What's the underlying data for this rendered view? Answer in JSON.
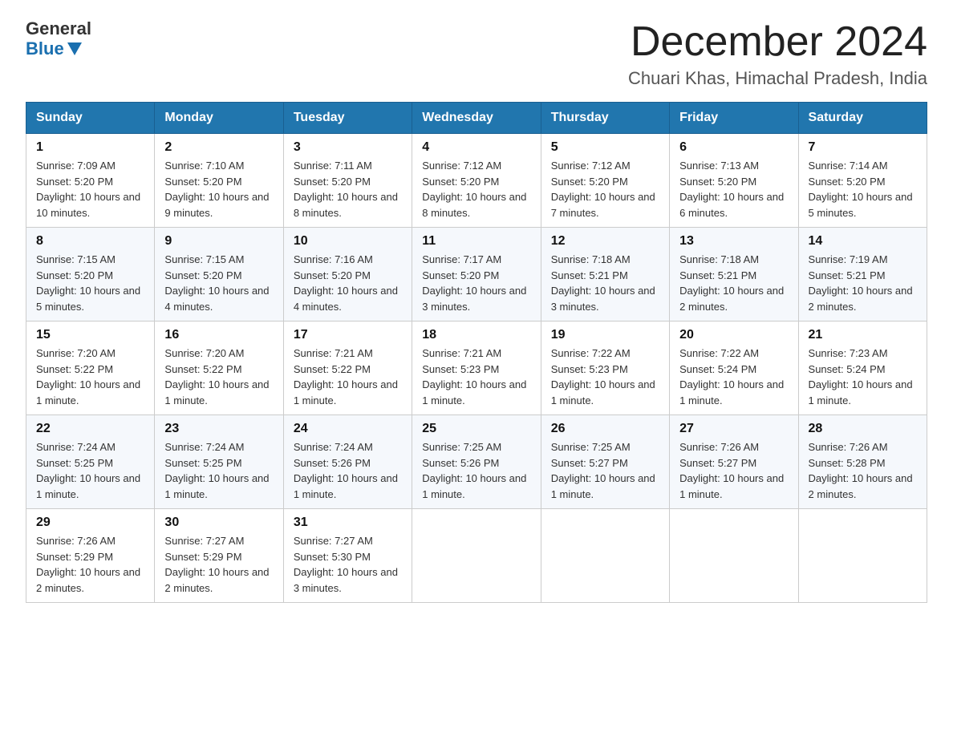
{
  "logo": {
    "general": "General",
    "blue": "Blue"
  },
  "header": {
    "month": "December 2024",
    "location": "Chuari Khas, Himachal Pradesh, India"
  },
  "weekdays": [
    "Sunday",
    "Monday",
    "Tuesday",
    "Wednesday",
    "Thursday",
    "Friday",
    "Saturday"
  ],
  "weeks": [
    [
      {
        "day": "1",
        "sunrise": "7:09 AM",
        "sunset": "5:20 PM",
        "daylight": "10 hours and 10 minutes."
      },
      {
        "day": "2",
        "sunrise": "7:10 AM",
        "sunset": "5:20 PM",
        "daylight": "10 hours and 9 minutes."
      },
      {
        "day": "3",
        "sunrise": "7:11 AM",
        "sunset": "5:20 PM",
        "daylight": "10 hours and 8 minutes."
      },
      {
        "day": "4",
        "sunrise": "7:12 AM",
        "sunset": "5:20 PM",
        "daylight": "10 hours and 8 minutes."
      },
      {
        "day": "5",
        "sunrise": "7:12 AM",
        "sunset": "5:20 PM",
        "daylight": "10 hours and 7 minutes."
      },
      {
        "day": "6",
        "sunrise": "7:13 AM",
        "sunset": "5:20 PM",
        "daylight": "10 hours and 6 minutes."
      },
      {
        "day": "7",
        "sunrise": "7:14 AM",
        "sunset": "5:20 PM",
        "daylight": "10 hours and 5 minutes."
      }
    ],
    [
      {
        "day": "8",
        "sunrise": "7:15 AM",
        "sunset": "5:20 PM",
        "daylight": "10 hours and 5 minutes."
      },
      {
        "day": "9",
        "sunrise": "7:15 AM",
        "sunset": "5:20 PM",
        "daylight": "10 hours and 4 minutes."
      },
      {
        "day": "10",
        "sunrise": "7:16 AM",
        "sunset": "5:20 PM",
        "daylight": "10 hours and 4 minutes."
      },
      {
        "day": "11",
        "sunrise": "7:17 AM",
        "sunset": "5:20 PM",
        "daylight": "10 hours and 3 minutes."
      },
      {
        "day": "12",
        "sunrise": "7:18 AM",
        "sunset": "5:21 PM",
        "daylight": "10 hours and 3 minutes."
      },
      {
        "day": "13",
        "sunrise": "7:18 AM",
        "sunset": "5:21 PM",
        "daylight": "10 hours and 2 minutes."
      },
      {
        "day": "14",
        "sunrise": "7:19 AM",
        "sunset": "5:21 PM",
        "daylight": "10 hours and 2 minutes."
      }
    ],
    [
      {
        "day": "15",
        "sunrise": "7:20 AM",
        "sunset": "5:22 PM",
        "daylight": "10 hours and 1 minute."
      },
      {
        "day": "16",
        "sunrise": "7:20 AM",
        "sunset": "5:22 PM",
        "daylight": "10 hours and 1 minute."
      },
      {
        "day": "17",
        "sunrise": "7:21 AM",
        "sunset": "5:22 PM",
        "daylight": "10 hours and 1 minute."
      },
      {
        "day": "18",
        "sunrise": "7:21 AM",
        "sunset": "5:23 PM",
        "daylight": "10 hours and 1 minute."
      },
      {
        "day": "19",
        "sunrise": "7:22 AM",
        "sunset": "5:23 PM",
        "daylight": "10 hours and 1 minute."
      },
      {
        "day": "20",
        "sunrise": "7:22 AM",
        "sunset": "5:24 PM",
        "daylight": "10 hours and 1 minute."
      },
      {
        "day": "21",
        "sunrise": "7:23 AM",
        "sunset": "5:24 PM",
        "daylight": "10 hours and 1 minute."
      }
    ],
    [
      {
        "day": "22",
        "sunrise": "7:24 AM",
        "sunset": "5:25 PM",
        "daylight": "10 hours and 1 minute."
      },
      {
        "day": "23",
        "sunrise": "7:24 AM",
        "sunset": "5:25 PM",
        "daylight": "10 hours and 1 minute."
      },
      {
        "day": "24",
        "sunrise": "7:24 AM",
        "sunset": "5:26 PM",
        "daylight": "10 hours and 1 minute."
      },
      {
        "day": "25",
        "sunrise": "7:25 AM",
        "sunset": "5:26 PM",
        "daylight": "10 hours and 1 minute."
      },
      {
        "day": "26",
        "sunrise": "7:25 AM",
        "sunset": "5:27 PM",
        "daylight": "10 hours and 1 minute."
      },
      {
        "day": "27",
        "sunrise": "7:26 AM",
        "sunset": "5:27 PM",
        "daylight": "10 hours and 1 minute."
      },
      {
        "day": "28",
        "sunrise": "7:26 AM",
        "sunset": "5:28 PM",
        "daylight": "10 hours and 2 minutes."
      }
    ],
    [
      {
        "day": "29",
        "sunrise": "7:26 AM",
        "sunset": "5:29 PM",
        "daylight": "10 hours and 2 minutes."
      },
      {
        "day": "30",
        "sunrise": "7:27 AM",
        "sunset": "5:29 PM",
        "daylight": "10 hours and 2 minutes."
      },
      {
        "day": "31",
        "sunrise": "7:27 AM",
        "sunset": "5:30 PM",
        "daylight": "10 hours and 3 minutes."
      },
      null,
      null,
      null,
      null
    ]
  ]
}
